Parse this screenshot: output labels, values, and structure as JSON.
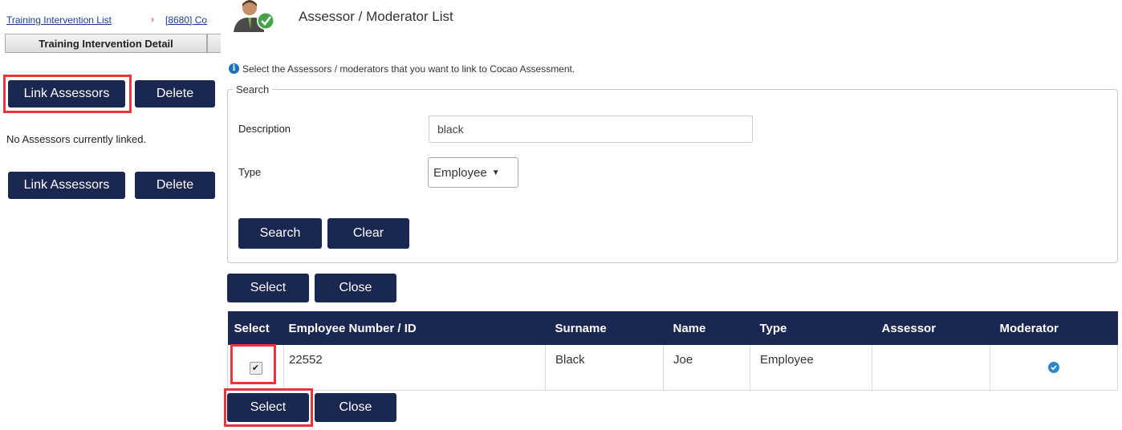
{
  "left": {
    "breadcrumb": {
      "list": "Training Intervention List",
      "separator": "›",
      "current": "[8680] Co"
    },
    "tab": "Training Intervention Detail",
    "link_assessors_label": "Link Assessors",
    "delete_label": "Delete",
    "empty_message": "No Assessors currently linked."
  },
  "dialog": {
    "title": "Assessor / Moderator List",
    "info": "Select the Assessors / moderators that you want to link to Cocao Assessment.",
    "search": {
      "legend": "Search",
      "description_label": "Description",
      "description_value": "black",
      "type_label": "Type",
      "type_value": "Employee",
      "type_arrow": "▼",
      "search_label": "Search",
      "clear_label": "Clear"
    },
    "select_label": "Select",
    "close_label": "Close",
    "table": {
      "headers": [
        "Select",
        "Employee Number / ID",
        "Surname",
        "Name",
        "Type",
        "Assessor",
        "Moderator"
      ],
      "rows": [
        {
          "checked": true,
          "id": "22552",
          "surname": "Black",
          "name": "Joe",
          "type": "Employee",
          "assessor": "",
          "moderator": true
        }
      ]
    }
  },
  "colors": {
    "button": "#1a2750",
    "highlight": "#e8353a",
    "link": "#1a3c8f",
    "check": "#2f87c8"
  },
  "icons": [
    "info-icon",
    "user-check-avatar-icon",
    "dropdown-arrow-icon",
    "checkmark-icon"
  ]
}
